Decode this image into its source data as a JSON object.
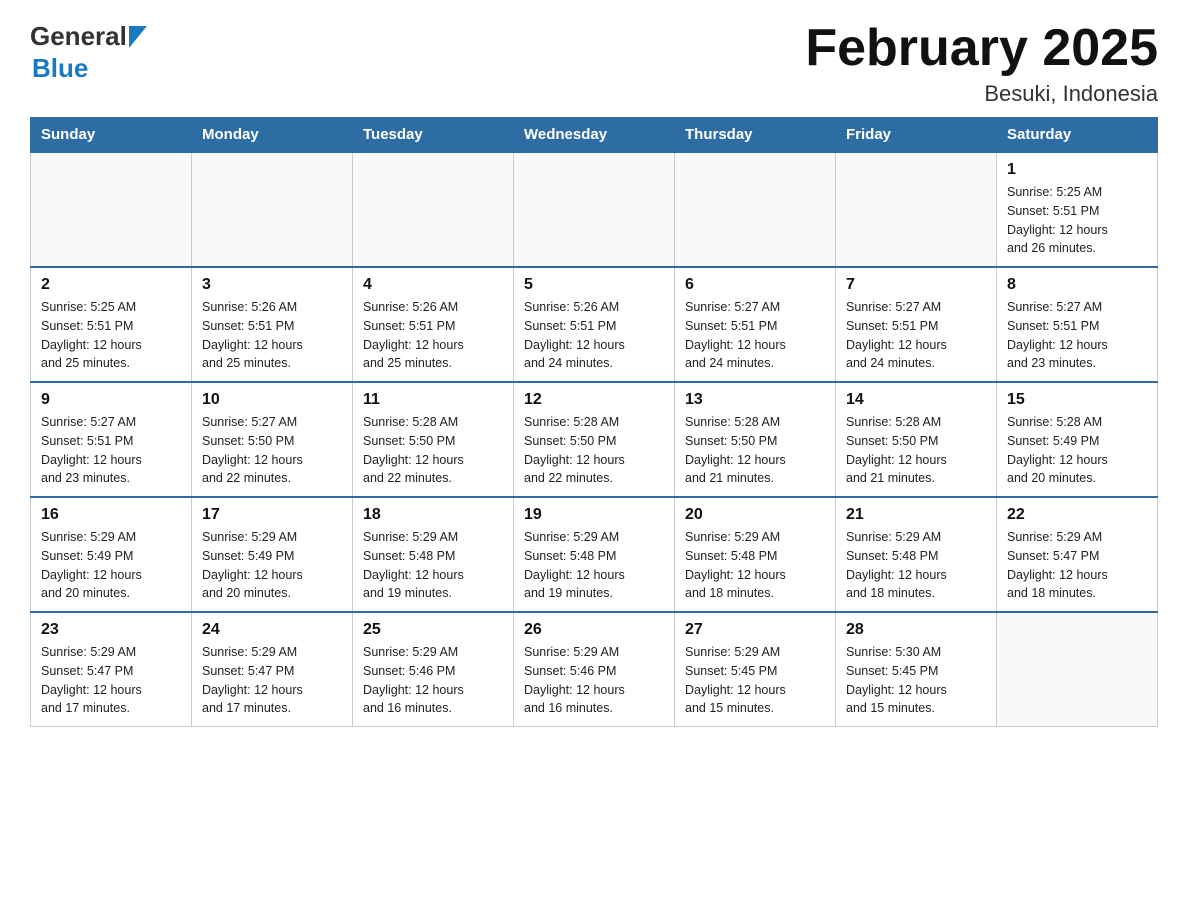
{
  "header": {
    "logo_general": "General",
    "logo_blue": "Blue",
    "title": "February 2025",
    "subtitle": "Besuki, Indonesia"
  },
  "weekdays": [
    "Sunday",
    "Monday",
    "Tuesday",
    "Wednesday",
    "Thursday",
    "Friday",
    "Saturday"
  ],
  "weeks": [
    [
      {
        "day": "",
        "info": ""
      },
      {
        "day": "",
        "info": ""
      },
      {
        "day": "",
        "info": ""
      },
      {
        "day": "",
        "info": ""
      },
      {
        "day": "",
        "info": ""
      },
      {
        "day": "",
        "info": ""
      },
      {
        "day": "1",
        "info": "Sunrise: 5:25 AM\nSunset: 5:51 PM\nDaylight: 12 hours\nand 26 minutes."
      }
    ],
    [
      {
        "day": "2",
        "info": "Sunrise: 5:25 AM\nSunset: 5:51 PM\nDaylight: 12 hours\nand 25 minutes."
      },
      {
        "day": "3",
        "info": "Sunrise: 5:26 AM\nSunset: 5:51 PM\nDaylight: 12 hours\nand 25 minutes."
      },
      {
        "day": "4",
        "info": "Sunrise: 5:26 AM\nSunset: 5:51 PM\nDaylight: 12 hours\nand 25 minutes."
      },
      {
        "day": "5",
        "info": "Sunrise: 5:26 AM\nSunset: 5:51 PM\nDaylight: 12 hours\nand 24 minutes."
      },
      {
        "day": "6",
        "info": "Sunrise: 5:27 AM\nSunset: 5:51 PM\nDaylight: 12 hours\nand 24 minutes."
      },
      {
        "day": "7",
        "info": "Sunrise: 5:27 AM\nSunset: 5:51 PM\nDaylight: 12 hours\nand 24 minutes."
      },
      {
        "day": "8",
        "info": "Sunrise: 5:27 AM\nSunset: 5:51 PM\nDaylight: 12 hours\nand 23 minutes."
      }
    ],
    [
      {
        "day": "9",
        "info": "Sunrise: 5:27 AM\nSunset: 5:51 PM\nDaylight: 12 hours\nand 23 minutes."
      },
      {
        "day": "10",
        "info": "Sunrise: 5:27 AM\nSunset: 5:50 PM\nDaylight: 12 hours\nand 22 minutes."
      },
      {
        "day": "11",
        "info": "Sunrise: 5:28 AM\nSunset: 5:50 PM\nDaylight: 12 hours\nand 22 minutes."
      },
      {
        "day": "12",
        "info": "Sunrise: 5:28 AM\nSunset: 5:50 PM\nDaylight: 12 hours\nand 22 minutes."
      },
      {
        "day": "13",
        "info": "Sunrise: 5:28 AM\nSunset: 5:50 PM\nDaylight: 12 hours\nand 21 minutes."
      },
      {
        "day": "14",
        "info": "Sunrise: 5:28 AM\nSunset: 5:50 PM\nDaylight: 12 hours\nand 21 minutes."
      },
      {
        "day": "15",
        "info": "Sunrise: 5:28 AM\nSunset: 5:49 PM\nDaylight: 12 hours\nand 20 minutes."
      }
    ],
    [
      {
        "day": "16",
        "info": "Sunrise: 5:29 AM\nSunset: 5:49 PM\nDaylight: 12 hours\nand 20 minutes."
      },
      {
        "day": "17",
        "info": "Sunrise: 5:29 AM\nSunset: 5:49 PM\nDaylight: 12 hours\nand 20 minutes."
      },
      {
        "day": "18",
        "info": "Sunrise: 5:29 AM\nSunset: 5:48 PM\nDaylight: 12 hours\nand 19 minutes."
      },
      {
        "day": "19",
        "info": "Sunrise: 5:29 AM\nSunset: 5:48 PM\nDaylight: 12 hours\nand 19 minutes."
      },
      {
        "day": "20",
        "info": "Sunrise: 5:29 AM\nSunset: 5:48 PM\nDaylight: 12 hours\nand 18 minutes."
      },
      {
        "day": "21",
        "info": "Sunrise: 5:29 AM\nSunset: 5:48 PM\nDaylight: 12 hours\nand 18 minutes."
      },
      {
        "day": "22",
        "info": "Sunrise: 5:29 AM\nSunset: 5:47 PM\nDaylight: 12 hours\nand 18 minutes."
      }
    ],
    [
      {
        "day": "23",
        "info": "Sunrise: 5:29 AM\nSunset: 5:47 PM\nDaylight: 12 hours\nand 17 minutes."
      },
      {
        "day": "24",
        "info": "Sunrise: 5:29 AM\nSunset: 5:47 PM\nDaylight: 12 hours\nand 17 minutes."
      },
      {
        "day": "25",
        "info": "Sunrise: 5:29 AM\nSunset: 5:46 PM\nDaylight: 12 hours\nand 16 minutes."
      },
      {
        "day": "26",
        "info": "Sunrise: 5:29 AM\nSunset: 5:46 PM\nDaylight: 12 hours\nand 16 minutes."
      },
      {
        "day": "27",
        "info": "Sunrise: 5:29 AM\nSunset: 5:45 PM\nDaylight: 12 hours\nand 15 minutes."
      },
      {
        "day": "28",
        "info": "Sunrise: 5:30 AM\nSunset: 5:45 PM\nDaylight: 12 hours\nand 15 minutes."
      },
      {
        "day": "",
        "info": ""
      }
    ]
  ]
}
